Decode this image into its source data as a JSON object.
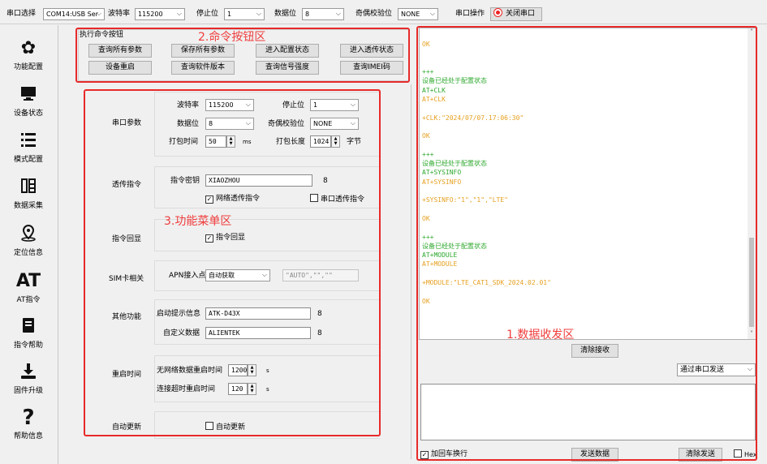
{
  "toolbar": {
    "port_label": "串口选择",
    "port_value": "COM14:USB Ser",
    "baud_label": "波特率",
    "baud_value": "115200",
    "stop_label": "停止位",
    "stop_value": "1",
    "data_label": "数据位",
    "data_value": "8",
    "parity_label": "奇偶校验位",
    "parity_value": "NONE",
    "op_label": "串口操作",
    "close_label": "关闭串口"
  },
  "sidebar": {
    "items": [
      {
        "label": "功能配置",
        "icon": "gear-icon"
      },
      {
        "label": "设备状态",
        "icon": "monitor-icon"
      },
      {
        "label": "模式配置",
        "icon": "list-icon"
      },
      {
        "label": "数据采集",
        "icon": "data-icon"
      },
      {
        "label": "定位信息",
        "icon": "location-icon"
      },
      {
        "label": "AT指令",
        "icon": "at-icon"
      },
      {
        "label": "指令帮助",
        "icon": "book-icon"
      },
      {
        "label": "固件升级",
        "icon": "upgrade-icon"
      },
      {
        "label": "帮助信息",
        "icon": "question-icon"
      }
    ]
  },
  "commands": {
    "title": "执行命令按钮",
    "buttons": [
      "查询所有参数",
      "保存所有参数",
      "进入配置状态",
      "进入透传状态",
      "设备重启",
      "查询软件版本",
      "查询信号强度",
      "查询IMEI码"
    ]
  },
  "annotations": {
    "cmd": "2.命令按钮区",
    "menu": "3.功能菜单区",
    "data": "1.数据收发区"
  },
  "serial_params": {
    "title": "串口参数",
    "baud_label": "波特率",
    "baud_value": "115200",
    "stop_label": "停止位",
    "stop_value": "1",
    "data_label": "数据位",
    "data_value": "8",
    "parity_label": "奇偶校验位",
    "parity_value": "NONE",
    "pack_time_label": "打包时间",
    "pack_time_value": "50",
    "pack_time_unit": "ms",
    "pack_len_label": "打包长度",
    "pack_len_value": "1024",
    "pack_len_unit": "字节"
  },
  "transparent": {
    "title": "透传指令",
    "key_label": "指令密钥",
    "key_value": "XIAOZHOU",
    "key_len": "8",
    "net_label": "网络透传指令",
    "serial_label": "串口透传指令",
    "net_checked": true,
    "serial_checked": false
  },
  "echo": {
    "title": "指令回显",
    "label": "指令回显",
    "checked": true
  },
  "sim": {
    "title": "SIM卡相关",
    "apn_label": "APN接入点",
    "apn_value": "自动获取",
    "apn_text": "\"AUTO\",\"\",\"\""
  },
  "other": {
    "title": "其他功能",
    "boot_label": "启动提示信息",
    "boot_value": "ATK-D43X",
    "boot_len": "8",
    "custom_label": "自定义数据",
    "custom_value": "ALIENTEK",
    "custom_len": "8"
  },
  "restart": {
    "title": "重启时间",
    "no_net_label": "无网络数据重启时间",
    "no_net_value": "1200",
    "no_net_unit": "s",
    "timeout_label": "连接超时重启时间",
    "timeout_value": "120",
    "timeout_unit": "s"
  },
  "auto_update": {
    "title": "自动更新",
    "label": "自动更新",
    "checked": false
  },
  "log": {
    "lines": [
      {
        "t": "",
        "c": "o"
      },
      {
        "t": "OK",
        "c": "o"
      },
      {
        "t": "",
        "c": "o"
      },
      {
        "t": "",
        "c": "o"
      },
      {
        "t": "+++",
        "c": "g"
      },
      {
        "t": "设备已经处于配置状态",
        "c": "g"
      },
      {
        "t": "AT+CLK",
        "c": "g"
      },
      {
        "t": "AT+CLK",
        "c": "o"
      },
      {
        "t": "",
        "c": "o"
      },
      {
        "t": "+CLK:\"2024/07/07.17:06:30\"",
        "c": "o"
      },
      {
        "t": "",
        "c": "o"
      },
      {
        "t": "OK",
        "c": "o"
      },
      {
        "t": "",
        "c": "o"
      },
      {
        "t": "+++",
        "c": "g"
      },
      {
        "t": "设备已经处于配置状态",
        "c": "g"
      },
      {
        "t": "AT+SYSINFO",
        "c": "g"
      },
      {
        "t": "AT+SYSINFO",
        "c": "o"
      },
      {
        "t": "",
        "c": "o"
      },
      {
        "t": "+SYSINFO:\"1\",\"1\",\"LTE\"",
        "c": "o"
      },
      {
        "t": "",
        "c": "o"
      },
      {
        "t": "OK",
        "c": "o"
      },
      {
        "t": "",
        "c": "o"
      },
      {
        "t": "+++",
        "c": "g"
      },
      {
        "t": "设备已经处于配置状态",
        "c": "g"
      },
      {
        "t": "AT+MODULE",
        "c": "g"
      },
      {
        "t": "AT+MODULE",
        "c": "o"
      },
      {
        "t": "",
        "c": "o"
      },
      {
        "t": "+MODULE:\"LTE_CAT1_SDK_2024.02.01\"",
        "c": "o"
      },
      {
        "t": "",
        "c": "o"
      },
      {
        "t": "OK",
        "c": "o"
      }
    ]
  },
  "receive": {
    "clear_label": "清除接收",
    "send_mode": "通过串口发送"
  },
  "send": {
    "crlf_label": "加回车换行",
    "crlf_checked": true,
    "send_label": "发送数据",
    "clear_label": "清除发送",
    "hex_label": "Hex",
    "hex_checked": false
  }
}
